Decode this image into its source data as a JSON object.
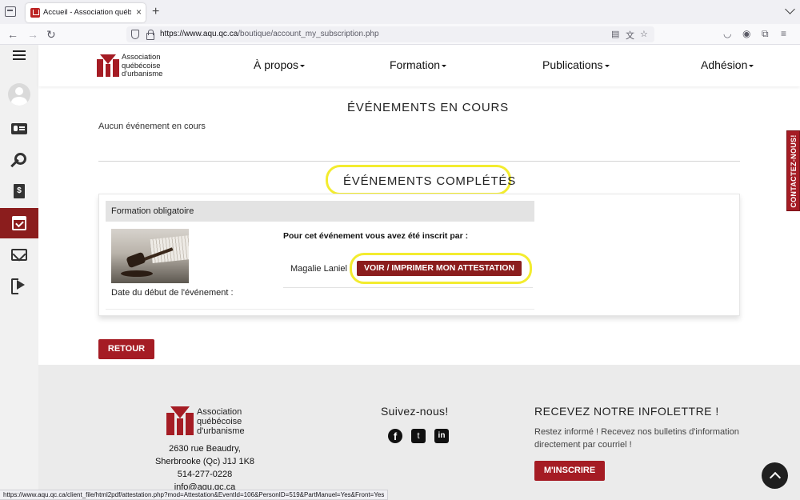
{
  "browser": {
    "tab_title": "Accueil - Association québécoise d'urbanisme",
    "url_host": "https://www.aqu.qc.ca",
    "url_path": "/boutique/account_my_subscription.php",
    "status_url": "https://www.aqu.qc.ca/client_file/html2pdf/attestation.php?mod=Attestation&EventId=106&PersonID=519&PartManuel=Yes&Front=Yes"
  },
  "header": {
    "logo_lines": [
      "Association",
      "québécoise",
      "d'urbanisme"
    ],
    "menu": [
      {
        "label": "À propos"
      },
      {
        "label": "Formation"
      },
      {
        "label": "Publications"
      },
      {
        "label": "Adhésion"
      }
    ]
  },
  "ongoing": {
    "title": "ÉVÉNEMENTS EN COURS",
    "empty_text": "Aucun événement en cours"
  },
  "completed": {
    "title": "ÉVÉNEMENTS COMPLÉTÉS",
    "event": {
      "category": "Formation obligatoire",
      "date_label": "Date du début de l'événement :",
      "registered_by_label": "Pour cet événement vous avez été inscrit par :",
      "registrant_name": "Magalie Laniel",
      "attestation_button": "VOIR / IMPRIMER MON ATTESTATION"
    }
  },
  "back_button": "RETOUR",
  "contact_tab": "CONTACTEZ-NOUS!",
  "footer": {
    "logo_lines": [
      "Association",
      "québécoise",
      "d'urbanisme"
    ],
    "address_lines": [
      "2630 rue Beaudry,",
      "Sherbrooke (Qc) J1J 1K8",
      "514-277-0228",
      "info@aqu.qc.ca"
    ],
    "follow_title": "Suivez-nous!",
    "social": [
      "facebook-icon",
      "twitter-icon",
      "linkedin-icon"
    ],
    "newsletter_title": "RECEVEZ NOTRE INFOLETTRE !",
    "newsletter_text": "Restez informé ! Recevez nos bulletins d'information directement par courriel !",
    "subscribe_button": "M'INSCRIRE"
  },
  "colors": {
    "brand_red": "#a51c24",
    "dark_red": "#8b1d1d",
    "highlight": "#f3ec2f"
  }
}
